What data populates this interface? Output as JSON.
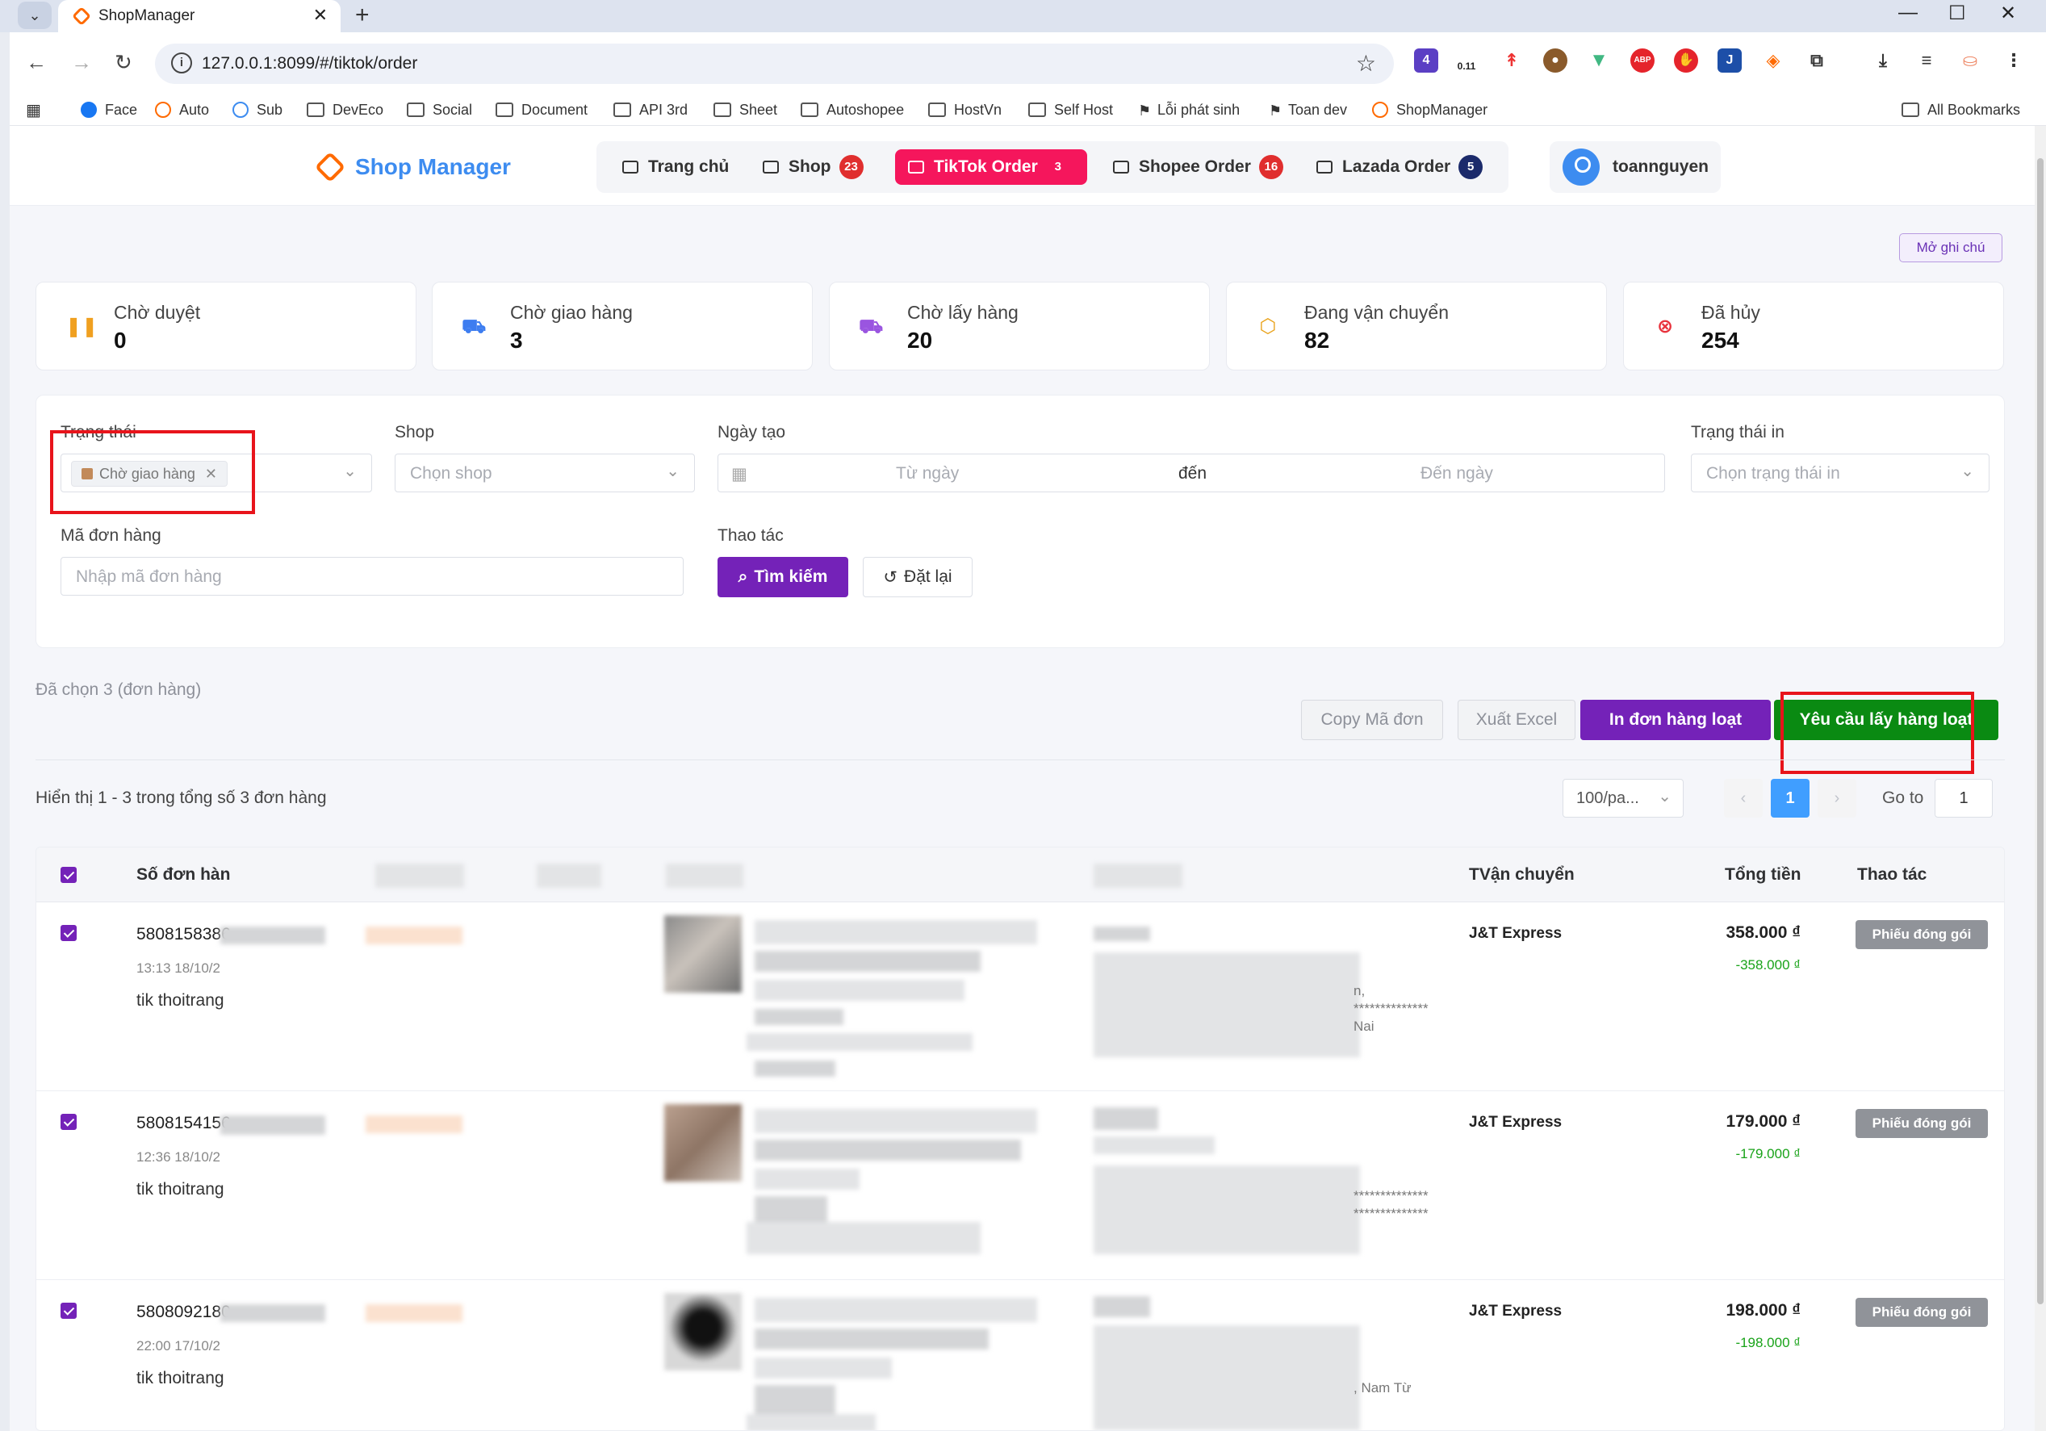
{
  "browser": {
    "tab_title": "ShopManager",
    "url": "127.0.0.1:8099/#/tiktok/order",
    "ext_counter": "0.11",
    "ext_badge": "4",
    "bookmarks": [
      "Face",
      "Auto",
      "Sub",
      "DevEco",
      "Social",
      "Document",
      "API 3rd",
      "Sheet",
      "Autoshopee",
      "HostVn",
      "Self Host",
      "Lỗi phát sinh",
      "Toan dev",
      "ShopManager"
    ],
    "all_bookmarks": "All Bookmarks"
  },
  "header": {
    "logo_text": "Shop Manager",
    "nav": [
      {
        "label": "Trang chủ",
        "badge": ""
      },
      {
        "label": "Shop",
        "badge": "23"
      },
      {
        "label": "TikTok Order",
        "badge": "3"
      },
      {
        "label": "Shopee Order",
        "badge": "16"
      },
      {
        "label": "Lazada Order",
        "badge": "5"
      }
    ],
    "username": "toannguyen"
  },
  "note_button": "Mở ghi chú",
  "stats": [
    {
      "label": "Chờ duyệt",
      "value": "0",
      "icon": "pause-icon",
      "color": "#f0a020"
    },
    {
      "label": "Chờ giao hàng",
      "value": "3",
      "icon": "truck-icon",
      "color": "#3d7df0"
    },
    {
      "label": "Chờ lấy hàng",
      "value": "20",
      "icon": "pickup-truck-icon",
      "color": "#9a55e0"
    },
    {
      "label": "Đang vận chuyển",
      "value": "82",
      "icon": "box-icon",
      "color": "#e9a21a"
    },
    {
      "label": "Đã hủy",
      "value": "254",
      "icon": "cancel-circle-icon",
      "color": "#e8323c"
    }
  ],
  "filters": {
    "status_label": "Trạng thái",
    "status_tag": "Chờ giao hàng",
    "shop_label": "Shop",
    "shop_placeholder": "Chọn shop",
    "date_label": "Ngày tạo",
    "date_from": "Từ ngày",
    "date_sep": "đến",
    "date_to": "Đến ngày",
    "print_label": "Trạng thái in",
    "print_placeholder": "Chọn trạng thái in",
    "order_label": "Mã đơn hàng",
    "order_placeholder": "Nhập mã đơn hàng",
    "actions_label": "Thao tác",
    "search_button": "Tìm kiếm",
    "reset_button": "Đặt lại"
  },
  "selection": {
    "selected_text": "Đã chọn 3 (đơn hàng)",
    "copy_button": "Copy Mã đơn",
    "export_button": "Xuất Excel",
    "print_button": "In đơn hàng loạt",
    "pickup_button": "Yêu cầu lấy hàng loạt"
  },
  "pagination": {
    "showing": "Hiển thị 1 - 3 trong tổng số 3 đơn hàng",
    "page_size": "100/pa...",
    "current_page": "1",
    "goto_label": "Go to",
    "goto_value": "1"
  },
  "table": {
    "columns": {
      "order_no": "Số đơn hàn",
      "carrier": "TVận chuyển",
      "total": "Tổng tiền",
      "actions": "Thao tác"
    },
    "rows": [
      {
        "order_no": "5808158386",
        "time": "13:13 18/10/2",
        "shop": "tik thoitrang",
        "addr_tail_1": "n,",
        "addr_tail_2": "**************",
        "addr_tail_3": "Nai",
        "carrier": "J&T Express",
        "amount": "358.000 ₫",
        "amount_neg": "-358.000 ₫",
        "action": "Phiếu đóng gói"
      },
      {
        "order_no": "5808154156",
        "time": "12:36 18/10/2",
        "shop": "tik thoitrang",
        "addr_tail_1": "**************",
        "addr_tail_2": "**************",
        "addr_tail_3": "",
        "carrier": "J&T Express",
        "amount": "179.000 ₫",
        "amount_neg": "-179.000 ₫",
        "action": "Phiếu đóng gói"
      },
      {
        "order_no": "5808092180",
        "time": "22:00 17/10/2",
        "shop": "tik thoitrang",
        "addr_tail_1": ", Nam Từ",
        "addr_tail_2": "",
        "addr_tail_3": "",
        "carrier": "J&T Express",
        "amount": "198.000 ₫",
        "amount_neg": "-198.000 ₫",
        "action": "Phiếu đóng gói"
      }
    ]
  }
}
